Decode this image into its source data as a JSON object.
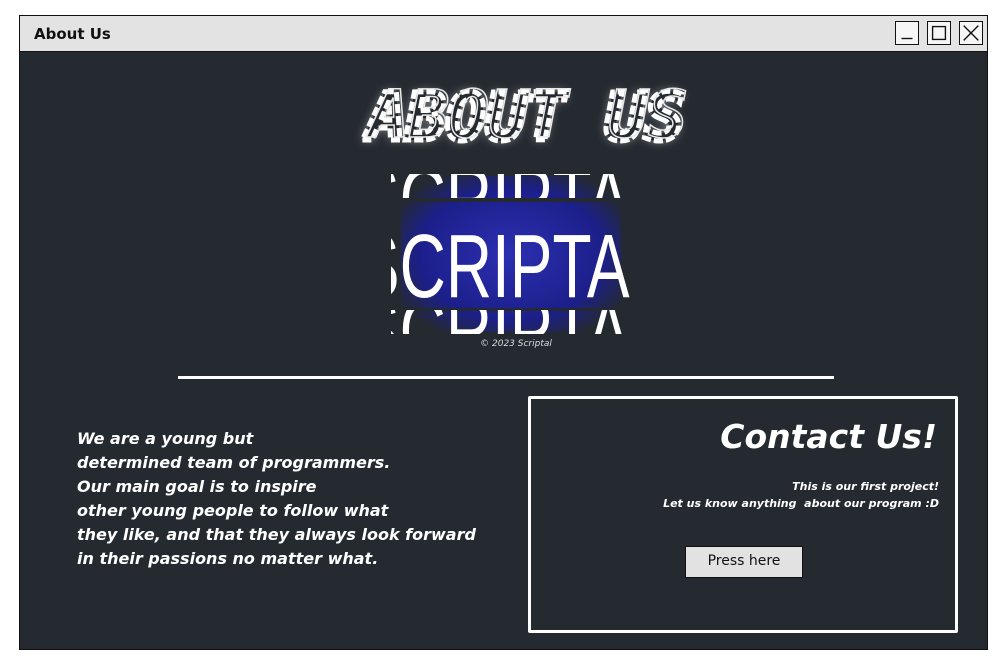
{
  "window": {
    "title": "About Us"
  },
  "header": {
    "title": "ABOUT US",
    "logo_text": "SCRIPTAL",
    "copyright": "© 2023 Scriptal"
  },
  "about": {
    "lines": [
      "We are a young but",
      "determined team of programmers.",
      "Our main goal is to inspire",
      "other young people to follow what",
      "they like, and that they always look forward",
      "in their passions no matter what."
    ]
  },
  "contact": {
    "title": "Contact Us!",
    "note_line1": "This is our first project!",
    "note_line2": "Let us know anything  about our program :D",
    "button_label": "Press here"
  },
  "colors": {
    "background": "#242a30",
    "titlebar": "#e3e3e3",
    "logo_glow": "#2c2fb0",
    "text": "#ffffff"
  }
}
